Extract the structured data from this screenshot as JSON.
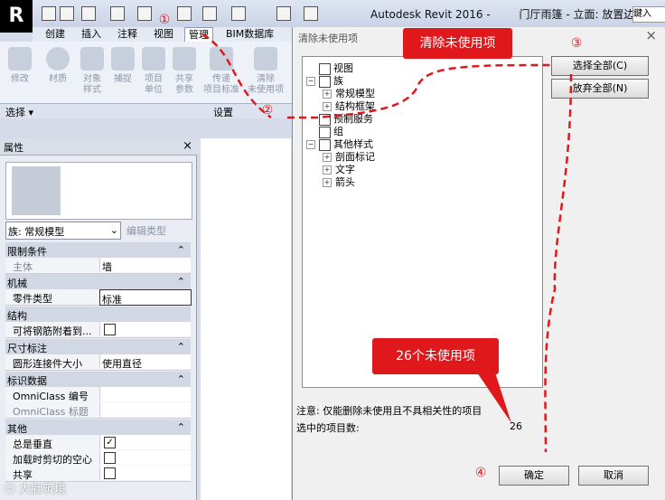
{
  "app": {
    "logo": "R",
    "title": "Autodesk Revit 2016 -",
    "view_title": "门厅雨篷 - 立面: 放置边",
    "search_hint": "鍵入"
  },
  "ribbon": {
    "tabs": [
      {
        "label": "创建"
      },
      {
        "label": "插入"
      },
      {
        "label": "注释"
      },
      {
        "label": "视图"
      },
      {
        "label": "管理"
      },
      {
        "label": "BIM数据库"
      }
    ],
    "buttons": [
      {
        "label": "修改",
        "icon": "cursor-icon"
      },
      {
        "label": "材质",
        "icon": "sphere-icon"
      },
      {
        "label": "对象\n样式",
        "icon": "object-style-icon"
      },
      {
        "label": "捕捉",
        "icon": "magnet-icon"
      },
      {
        "label": "项目\n单位",
        "icon": "units-icon"
      },
      {
        "label": "共享\n参数",
        "icon": "shared-params-icon"
      },
      {
        "label": "传递\n项目标准",
        "icon": "transfer-icon"
      },
      {
        "label": "清除\n未使用项",
        "icon": "purge-icon"
      }
    ],
    "panel_select": "选择 ▾",
    "panel_settings": "设置"
  },
  "properties": {
    "title": "属性",
    "close": "×",
    "family_type": "族: 常规模型",
    "edit_type": "编辑类型",
    "groups": [
      {
        "name": "限制条件",
        "rows": [
          {
            "k": "主体",
            "v": "墙",
            "dim": true
          }
        ]
      },
      {
        "name": "机械",
        "rows": [
          {
            "k": "零件类型",
            "v": "标准",
            "dim": false
          }
        ]
      },
      {
        "name": "结构",
        "rows": [
          {
            "k": "可将钢筋附着到...",
            "v": "",
            "check": false
          }
        ]
      },
      {
        "name": "尺寸标注",
        "rows": [
          {
            "k": "圆形连接件大小",
            "v": "使用直径"
          }
        ]
      },
      {
        "name": "标识数据",
        "rows": [
          {
            "k": "OmniClass 编号",
            "v": ""
          },
          {
            "k": "OmniClass 标题",
            "v": "",
            "dim": true
          }
        ]
      },
      {
        "name": "其他",
        "rows": [
          {
            "k": "总是垂直",
            "check": true
          },
          {
            "k": "加载时剪切的空心",
            "check": false
          },
          {
            "k": "共享",
            "check": false
          }
        ]
      }
    ]
  },
  "dialog": {
    "title": "清除未使用项",
    "close": "×",
    "tree": [
      {
        "label": "视图",
        "level": 0,
        "toggle": "",
        "icon": "view-icon"
      },
      {
        "label": "族",
        "level": 0,
        "toggle": "−",
        "icon": "family-icon"
      },
      {
        "label": "常规模型",
        "level": 1,
        "toggle": "+"
      },
      {
        "label": "结构框架",
        "level": 1,
        "toggle": "+"
      },
      {
        "label": "预制服务",
        "level": 0,
        "toggle": "",
        "icon": "service-icon"
      },
      {
        "label": "组",
        "level": 0,
        "toggle": "",
        "icon": "group-icon"
      },
      {
        "label": "其他样式",
        "level": 0,
        "toggle": "−",
        "icon": "style-icon"
      },
      {
        "label": "剖面标记",
        "level": 1,
        "toggle": "+"
      },
      {
        "label": "文字",
        "level": 1,
        "toggle": "+"
      },
      {
        "label": "箭头",
        "level": 1,
        "toggle": "+"
      }
    ],
    "select_all": "选择全部(C)",
    "discard_all": "放弃全部(N)",
    "note": "注意: 仅能删除未使用且不具相关性的项目",
    "count_label": "选中的项目数:",
    "count_value": "26",
    "ok": "确定",
    "cancel": "取消"
  },
  "annotations": {
    "callout_purge": "清除未使用项",
    "callout_count": "26个未使用项",
    "step1": "①",
    "step2": "②",
    "step3": "③",
    "step4": "④",
    "accent": "#e0181c"
  },
  "watermark": "ⓔ 大肚筑境"
}
